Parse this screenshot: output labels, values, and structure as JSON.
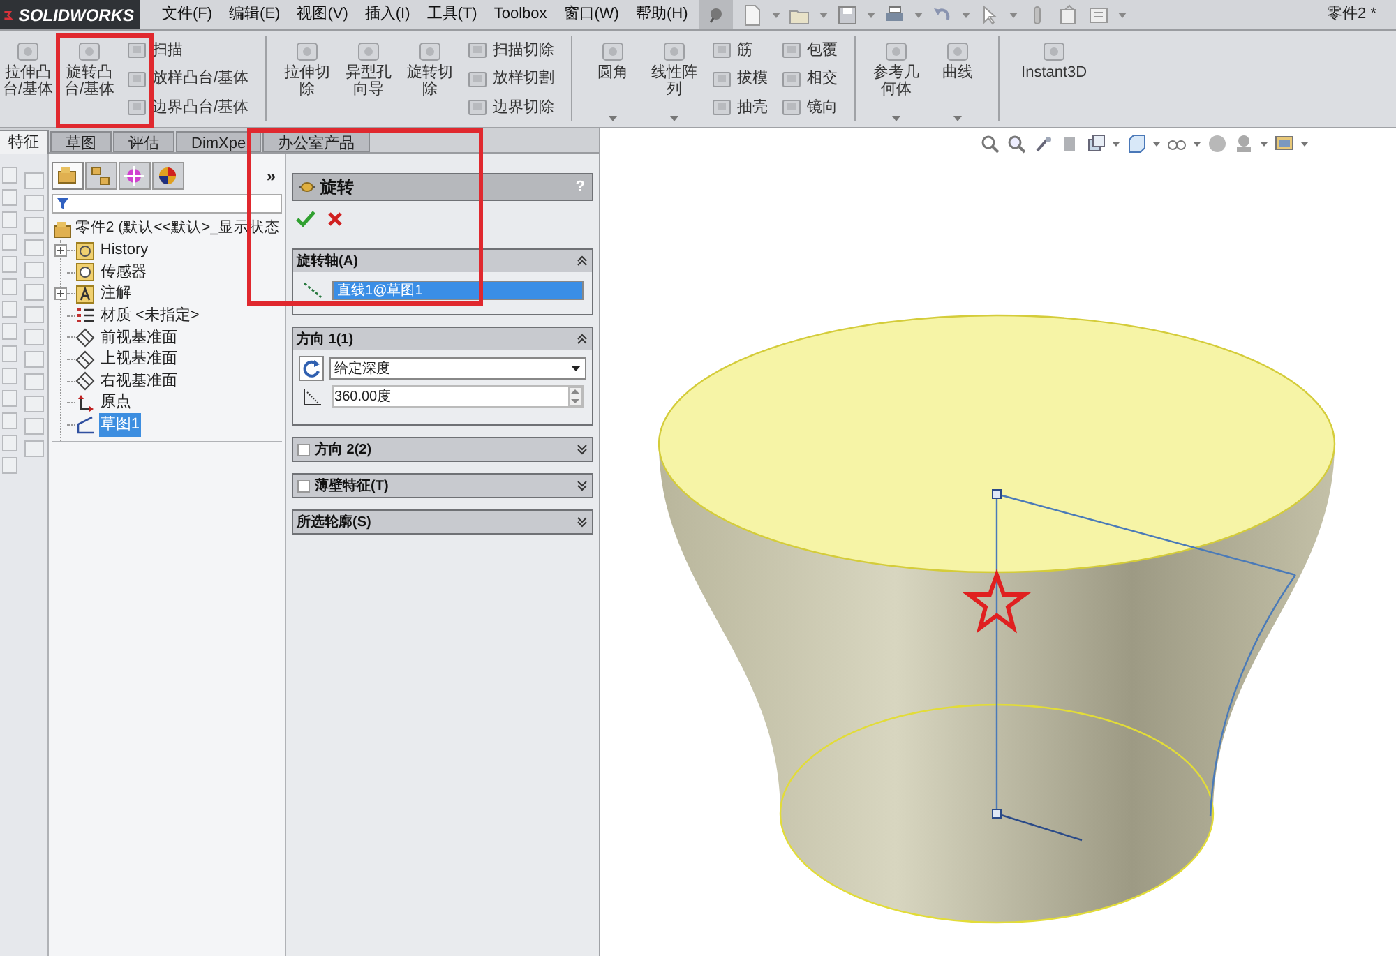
{
  "app": {
    "logo": "SOLIDWORKS",
    "document_title": "零件2 *"
  },
  "menu": [
    "文件(F)",
    "编辑(E)",
    "视图(V)",
    "插入(I)",
    "工具(T)",
    "Toolbox",
    "窗口(W)",
    "帮助(H)"
  ],
  "ribbon": [
    {
      "kind": "large",
      "label": "拉伸凸台/基体",
      "dropdown": false
    },
    {
      "kind": "large",
      "label": "旋转凸台/基体",
      "dropdown": false
    },
    {
      "kind": "stack",
      "labels": [
        "扫描",
        "放样凸台/基体",
        "边界凸台/基体"
      ]
    },
    {
      "kind": "separator"
    },
    {
      "kind": "large",
      "label": "拉伸切除",
      "dropdown": false
    },
    {
      "kind": "large",
      "label": "异型孔向导",
      "dropdown": false
    },
    {
      "kind": "large",
      "label": "旋转切除",
      "dropdown": false
    },
    {
      "kind": "stack",
      "labels": [
        "扫描切除",
        "放样切割",
        "边界切除"
      ]
    },
    {
      "kind": "separator"
    },
    {
      "kind": "large",
      "label": "圆角",
      "dropdown": true
    },
    {
      "kind": "large",
      "label": "线性阵列",
      "dropdown": true
    },
    {
      "kind": "stack",
      "labels": [
        "筋",
        "拔模",
        "抽壳"
      ]
    },
    {
      "kind": "stack",
      "labels": [
        "包覆",
        "相交",
        "镜向"
      ]
    },
    {
      "kind": "separator"
    },
    {
      "kind": "large",
      "label": "参考几何体",
      "dropdown": true
    },
    {
      "kind": "large",
      "label": "曲线",
      "dropdown": true
    },
    {
      "kind": "separator"
    },
    {
      "kind": "large",
      "label": "Instant3D",
      "dropdown": false
    }
  ],
  "tabs": [
    {
      "label": "特征",
      "selected": true
    },
    {
      "label": "草图",
      "selected": false
    },
    {
      "label": "评估",
      "selected": false
    },
    {
      "label": "DimXpe",
      "selected": false
    },
    {
      "label": "办公室产品",
      "selected": false
    }
  ],
  "tree_panel": {
    "tabs": [
      {
        "selected": true
      },
      {
        "selected": false
      },
      {
        "selected": false
      },
      {
        "selected": false
      }
    ],
    "more": "»",
    "root": "零件2  (默认<<默认>_显示状态",
    "items": [
      {
        "kind": "history",
        "label": "History",
        "expandable": true,
        "selected": false
      },
      {
        "kind": "sensor",
        "label": "传感器",
        "expandable": false,
        "selected": false
      },
      {
        "kind": "annotation",
        "label": "注解",
        "expandable": true,
        "selected": false
      },
      {
        "kind": "material",
        "label": "材质 <未指定>",
        "expandable": false,
        "selected": false
      },
      {
        "kind": "plane",
        "label": "前视基准面",
        "expandable": false,
        "selected": false
      },
      {
        "kind": "plane",
        "label": "上视基准面",
        "expandable": false,
        "selected": false
      },
      {
        "kind": "plane",
        "label": "右视基准面",
        "expandable": false,
        "selected": false
      },
      {
        "kind": "origin",
        "label": "原点",
        "expandable": false,
        "selected": false
      },
      {
        "kind": "sketch",
        "label": "草图1",
        "expandable": false,
        "selected": true
      }
    ]
  },
  "property_manager": {
    "title": "旋转",
    "help": "?",
    "sections": [
      {
        "kind": "axis",
        "title": "旋转轴(A)",
        "expanded": true,
        "value": "直线1@草图1"
      },
      {
        "kind": "direction",
        "title": "方向 1(1)",
        "expanded": true,
        "end_condition": "给定深度",
        "angle": "360.00度"
      },
      {
        "kind": "plain",
        "title": "方向 2(2)",
        "expanded": false,
        "checked": false
      },
      {
        "kind": "plain",
        "title": "薄壁特征(T)",
        "expanded": false,
        "checked": false
      },
      {
        "kind": "plain",
        "title": "所选轮廓(S)",
        "expanded": false
      }
    ]
  }
}
